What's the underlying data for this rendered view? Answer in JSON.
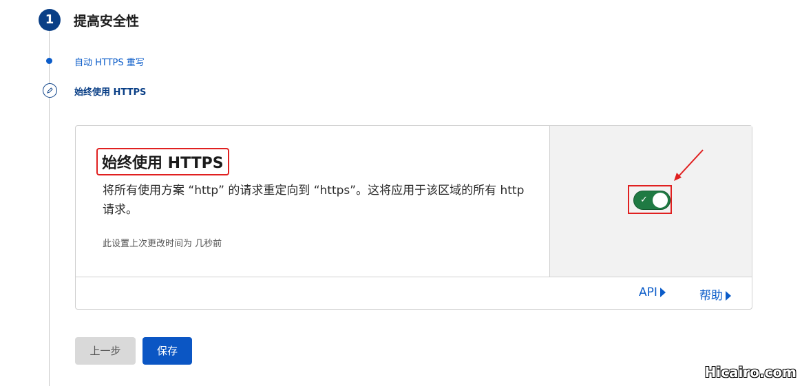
{
  "step": {
    "number": "1",
    "title": "提高安全性",
    "substeps": [
      {
        "label": "自动 HTTPS 重写"
      },
      {
        "label": "始终使用 HTTPS"
      }
    ]
  },
  "card": {
    "title": "始终使用 HTTPS",
    "description": "将所有使用方案 “http” 的请求重定向到 “https”。这将应用于该区域的所有 http 请求。",
    "meta": "此设置上次更改时间为 几秒前",
    "toggle": {
      "state": "on",
      "check": "✓",
      "color": "#1f7a43"
    },
    "links": {
      "api": "API",
      "help": "帮助"
    }
  },
  "buttons": {
    "prev": "上一步",
    "save": "保存"
  },
  "watermark": "Hicairo.com",
  "colors": {
    "accent": "#0b5cc9",
    "highlight": "#e02020"
  }
}
